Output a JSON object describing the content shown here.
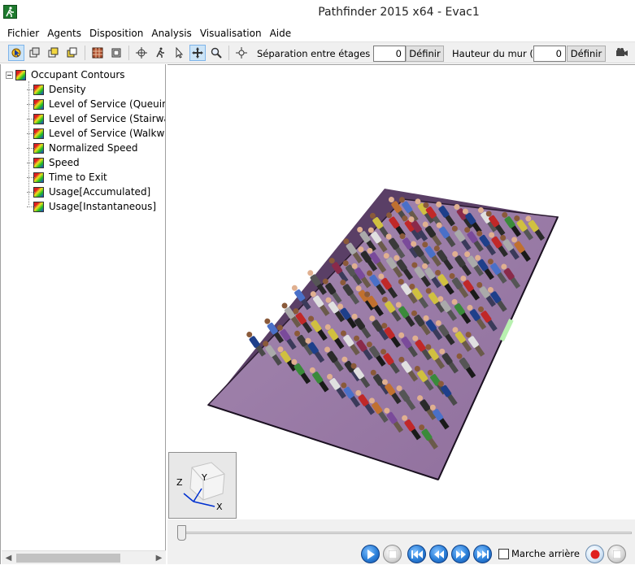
{
  "window": {
    "title": "Pathfinder 2015 x64 - Evac1"
  },
  "menu": {
    "items": [
      "Fichier",
      "Agents",
      "Disposition",
      "Analysis",
      "Visualisation",
      "Aide"
    ]
  },
  "toolbar": {
    "floor_sep_label": "Séparation entre étages (m):",
    "floor_sep_value": "0",
    "floor_sep_button": "Définir",
    "wall_height_label": "Hauteur du mur (m):",
    "wall_height_value": "0",
    "wall_height_button": "Définir"
  },
  "tree": {
    "root": "Occupant Contours",
    "children": [
      "Density",
      "Level of Service (Queuing",
      "Level of Service (Stairway)",
      "Level of Service (Walkway",
      "Normalized Speed",
      "Speed",
      "Time to Exit",
      "Usage[Accumulated]",
      "Usage[Instantaneous]"
    ]
  },
  "viewport": {
    "axes": {
      "x": "X",
      "y": "Y",
      "z": "Z"
    },
    "floor_color": "#9b7aa6"
  },
  "playback": {
    "reverse_label": "Marche arrière"
  },
  "colors": {
    "accent": "#2b7fd8",
    "record": "#e02020"
  }
}
